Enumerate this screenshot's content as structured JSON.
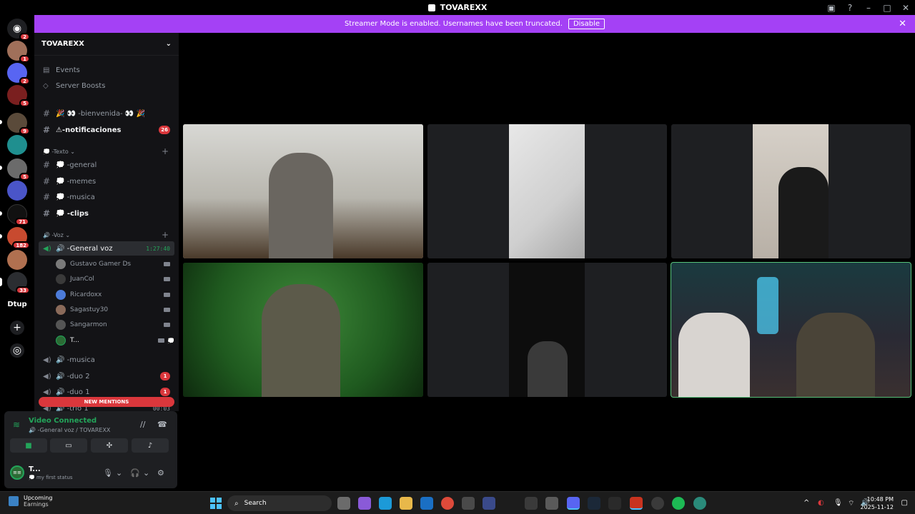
{
  "window": {
    "title": "TOVAREXX"
  },
  "banner": {
    "message": "Streamer Mode is enabled. Usernames have been truncated.",
    "button": "Disable"
  },
  "rail": {
    "badges": [
      "2",
      "1",
      "2",
      "5",
      "9",
      "5",
      "71",
      "182",
      "33"
    ],
    "folder_label": "Dtup"
  },
  "guild": {
    "name": "TOVAREXX"
  },
  "sidebar": {
    "events": "Events",
    "boosts": "Server Boosts",
    "channels_top": [
      {
        "name": "🎉 👀 -bienvenida- 👀 🎉",
        "bright": false
      },
      {
        "name": "⚠-notificaciones",
        "bright": true,
        "mentions": "26"
      }
    ],
    "text_category": "💭 -Texto ⌄",
    "text_channels": [
      "💭 -general",
      "💭 -memes",
      "💭 -musica",
      "💭 -clips"
    ],
    "voice_category": "🔊 -Voz ⌄",
    "active_voice": {
      "name": "🔊 -General voz",
      "timer": "1:27:40"
    },
    "voice_users": [
      "Gustavo Gamer Ds",
      "JuanCol",
      "Ricardoxx",
      "Sagastuy30",
      "Sangarmon",
      "T..."
    ],
    "voice_channels": [
      {
        "name": "🔊 -musica"
      },
      {
        "name": "🔊 -duo 2",
        "mentions": "1"
      },
      {
        "name": "🔊 -duo 1",
        "mentions": "1"
      },
      {
        "name": "🔊 -trio 1",
        "timer": "00:03"
      }
    ],
    "new_mentions": "NEW MENTIONS"
  },
  "voice_panel": {
    "status": "Video Connected",
    "channel": "🔊 -General voz / TOVAREXX",
    "user_name": "T...",
    "user_status": "💭 my first status",
    "avatar_text": "≡≡"
  },
  "taskbar": {
    "weather_title": "Upcoming",
    "weather_sub": "Earnings",
    "search": "Search",
    "time": "10:48 PM",
    "date": "2025-11-12"
  },
  "colors": {
    "banner": "#a441f5",
    "mention": "#da373c",
    "connected": "#23a55a",
    "speaking_border": "#57c27a"
  }
}
